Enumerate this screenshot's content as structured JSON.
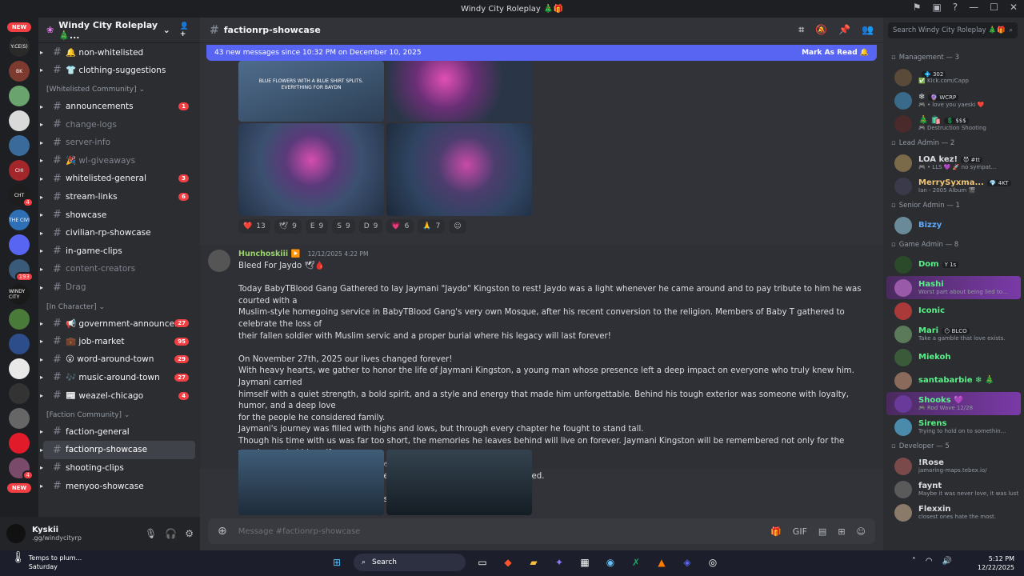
{
  "window": {
    "title": "Windy City Roleplay 🎄🎁"
  },
  "servers": {
    "new_top": "NEW",
    "new_bottom": "NEW",
    "items": [
      {
        "label": "Y:CE(S)",
        "color": "#2a2a2a",
        "badge": ""
      },
      {
        "label": "BK",
        "color": "#7d3a2e",
        "badge": ""
      },
      {
        "label": "",
        "color": "#6aa36e",
        "badge": ""
      },
      {
        "label": "",
        "color": "#d9d9d9",
        "badge": ""
      },
      {
        "label": "",
        "color": "#3a6a9a",
        "badge": ""
      },
      {
        "label": "CHI",
        "color": "#a3262a",
        "badge": ""
      },
      {
        "label": "CHT",
        "color": "#1d1d1d",
        "badge": "4"
      },
      {
        "label": "THE CIVI",
        "color": "#2f6fb5",
        "badge": ""
      },
      {
        "label": "",
        "color": "#5865f2",
        "badge": ""
      },
      {
        "label": "",
        "color": "#3a5a7a",
        "badge": "193"
      },
      {
        "label": "WINDY CITY",
        "color": "#1a1a1a",
        "badge": ""
      },
      {
        "label": "",
        "color": "#4a7a3a",
        "badge": ""
      },
      {
        "label": "",
        "color": "#2c4d8a",
        "badge": ""
      },
      {
        "label": "",
        "color": "#e8e8e8",
        "badge": ""
      },
      {
        "label": "",
        "color": "#333333",
        "badge": ""
      },
      {
        "label": "",
        "color": "#666666",
        "badge": ""
      },
      {
        "label": "",
        "color": "#e21b2b",
        "badge": ""
      },
      {
        "label": "",
        "color": "#7a4a6a",
        "badge": "4"
      }
    ]
  },
  "guild": {
    "name": "Windy City Roleplay 🎄...",
    "chevron": "⌄",
    "invite_icon": "👤+"
  },
  "channels": [
    {
      "type": "ch",
      "name": "🔔 non-whitelisted",
      "dim": false,
      "count": ""
    },
    {
      "type": "ch",
      "name": "👕 clothing-suggestions",
      "dim": false,
      "count": ""
    },
    {
      "type": "cat",
      "name": "[Whitelisted Community] ⌄"
    },
    {
      "type": "ch",
      "name": "announcements",
      "dim": false,
      "count": "1"
    },
    {
      "type": "ch",
      "name": "change-logs",
      "dim": true,
      "count": ""
    },
    {
      "type": "ch",
      "name": "server-info",
      "dim": true,
      "count": ""
    },
    {
      "type": "ch",
      "name": "🎉 wl-giveaways",
      "dim": true,
      "count": ""
    },
    {
      "type": "ch",
      "name": "whitelisted-general",
      "dim": false,
      "count": "3"
    },
    {
      "type": "ch",
      "name": "stream-links",
      "dim": false,
      "count": "6"
    },
    {
      "type": "ch",
      "name": "showcase",
      "dim": false,
      "count": ""
    },
    {
      "type": "ch",
      "name": "civilian-rp-showcase",
      "dim": false,
      "count": ""
    },
    {
      "type": "ch",
      "name": "in-game-clips",
      "dim": false,
      "count": ""
    },
    {
      "type": "ch",
      "name": "content-creators",
      "dim": true,
      "count": ""
    },
    {
      "type": "ch",
      "name": "Drag",
      "dim": true,
      "count": ""
    },
    {
      "type": "cat",
      "name": "[In Character] ⌄"
    },
    {
      "type": "ch",
      "name": "📢 government-announce...",
      "dim": false,
      "count": "27"
    },
    {
      "type": "ch",
      "name": "💼 job-market",
      "dim": false,
      "count": "95"
    },
    {
      "type": "ch",
      "name": "😮 word-around-town",
      "dim": false,
      "count": "29"
    },
    {
      "type": "ch",
      "name": "🎶 music-around-town",
      "dim": false,
      "count": "27"
    },
    {
      "type": "ch",
      "name": "📰 weazel-chicago",
      "dim": false,
      "count": "4"
    },
    {
      "type": "cat",
      "name": "[Faction Community] ⌄"
    },
    {
      "type": "ch",
      "name": "faction-general",
      "dim": false,
      "count": ""
    },
    {
      "type": "ch",
      "name": "factionrp-showcase",
      "dim": false,
      "count": "",
      "selected": true
    },
    {
      "type": "ch",
      "name": "shooting-clips",
      "dim": false,
      "count": ""
    },
    {
      "type": "ch",
      "name": "menyoo-showcase",
      "dim": false,
      "count": ""
    }
  ],
  "user": {
    "name": "Kyskii",
    "sub": ".gg/windycityrp"
  },
  "header": {
    "channel": "factionrp-showcase",
    "search_placeholder": "Search Windy City Roleplay 🎄🎁"
  },
  "newbar": {
    "text": "43 new messages since 10:32 PM on December 10, 2025",
    "mark": "Mark As Read 🔔"
  },
  "image_caption": "BLUE FLOWERS WITH A BLUE SHIRT SPLITS. EVERYTHING FOR BAYDN",
  "reactions": [
    {
      "emoji": "❤️",
      "count": "13"
    },
    {
      "emoji": "🕊",
      "count": "9"
    },
    {
      "emoji": "E",
      "count": "9"
    },
    {
      "emoji": "S",
      "count": "9"
    },
    {
      "emoji": "D",
      "count": "9"
    },
    {
      "emoji": "💗",
      "count": "6"
    },
    {
      "emoji": "🙏",
      "count": "7"
    },
    {
      "emoji": "☺",
      "count": ""
    }
  ],
  "message": {
    "author": "Hunchoskiii ▶️",
    "time": "12/12/2025 4:22 PM",
    "lines": [
      "Bleed For Jaydo 🕊🩸",
      "",
      "Today BabyTBlood Gang Gathered to lay Jaymani \"Jaydo\" Kingston to rest! Jaydo was a light whenever he came around and to pay tribute to him he was courted with a",
      "Muslim-style homegoing service in BabyTBlood Gang's very own Mosque, after his recent conversion to the religion. Members of Baby T gathered to celebrate the loss of",
      "their fallen soldier with Muslim servic and a proper burial where his legacy will last forever!",
      "",
      "On November 27th, 2025 our lives changed forever!",
      "With heavy hearts, we gather to honor the life of Jaymani Kingston, a young man whose presence left a deep impact on everyone who truly knew him. Jaymani carried",
      "himself with a quiet strength, a bold spirit, and a style and energy that made him unforgettable. Behind his tough exterior was someone with loyalty, humor, and a deep love",
      "for the people he considered family.",
      "Jaymani's journey was filled with highs and lows, but through every chapter he fought to stand tall.",
      "Though his time with us was far too short, the memories he leaves behind will live on forever. Jaymani Kingston will be remembered not only for the way he carried himself,",
      "but for the heart he shared with those lucky enough to be in his circle.",
      "May he rest in peace, and may his legacy continue in the lives he touched.",
      "Forever Loved. Forever Missed.",
      "Rest in Peace, Jaymani \"Jaydo\" Kingston."
    ]
  },
  "composer": {
    "placeholder": "Message #factionrp-showcase"
  },
  "members": [
    {
      "type": "cat",
      "name": "Management — 3"
    },
    {
      "type": "m",
      "name": "",
      "tag": "💠 302",
      "status": "✅ Kick.com/Capp",
      "color": "#dbdee1",
      "hl": false
    },
    {
      "type": "m",
      "name": "❄",
      "tag": "🔮 WCRP",
      "status": "🎮 • love you yaeski ❤️",
      "color": "#dbdee1",
      "hl": false
    },
    {
      "type": "m",
      "name": "🎄 🛍️",
      "tag": "💲 $$$",
      "status": "🎮 Destruction Shooting",
      "color": "#dbdee1",
      "hl": false
    },
    {
      "type": "cat",
      "name": "Lead Admin — 2"
    },
    {
      "type": "m",
      "name": "LOA kez!",
      "tag": "😈 #tt",
      "status": "🎮 • LLS 💜 🚀 no sympat...",
      "color": "#dbdee1",
      "hl": false
    },
    {
      "type": "m",
      "name": "MerrySyxma...",
      "tag": "💎 4KT",
      "status": "Ian - 2005 Album 🎬",
      "color": "#f0c674",
      "hl": false
    },
    {
      "type": "cat",
      "name": "Senior Admin — 1"
    },
    {
      "type": "m",
      "name": "Bizzy",
      "tag": "",
      "status": "",
      "color": "#5aa9ff",
      "hl": false
    },
    {
      "type": "cat",
      "name": "Game Admin — 8"
    },
    {
      "type": "m",
      "name": "Dom",
      "tag": "Y 1s",
      "status": "",
      "color": "#57f287",
      "hl": false
    },
    {
      "type": "m",
      "name": "Hashi",
      "tag": "",
      "status": "Worst part about being lied to...",
      "color": "#57f287",
      "hl": true
    },
    {
      "type": "m",
      "name": "Iconic",
      "tag": "",
      "status": "",
      "color": "#57f287",
      "hl": false
    },
    {
      "type": "m",
      "name": "Mari",
      "tag": "😶 BLCO",
      "status": "Take a gamble that love exists.",
      "color": "#57f287",
      "hl": false
    },
    {
      "type": "m",
      "name": "Miekoh",
      "tag": "",
      "status": "",
      "color": "#57f287",
      "hl": false
    },
    {
      "type": "m",
      "name": "santabarbie ❄ 🎄",
      "tag": "",
      "status": "",
      "color": "#57f287",
      "hl": false
    },
    {
      "type": "m",
      "name": "Shooks 💜",
      "tag": "",
      "status": "🎮 Rod Wave 12/28",
      "color": "#57f287",
      "hl": true
    },
    {
      "type": "m",
      "name": "Sirens",
      "tag": "",
      "status": "Trying to hold on to somethin...",
      "color": "#57f287",
      "hl": false
    },
    {
      "type": "cat",
      "name": "Developer — 5"
    },
    {
      "type": "m",
      "name": "!Rose",
      "tag": "",
      "status": "jamaring-maps.tebex.io/",
      "color": "#dbdee1",
      "hl": false
    },
    {
      "type": "m",
      "name": "faynt",
      "tag": "",
      "status": "Maybe it was never love, it was lust",
      "color": "#dbdee1",
      "hl": false
    },
    {
      "type": "m",
      "name": "Flexxin",
      "tag": "",
      "status": "closest ones hate the most.",
      "color": "#dbdee1",
      "hl": false
    }
  ],
  "taskbar": {
    "weather_temp": "Temps to plum...",
    "weather_day": "Saturday",
    "search": "Search",
    "time": "5:12 PM",
    "date": "12/22/2025"
  }
}
